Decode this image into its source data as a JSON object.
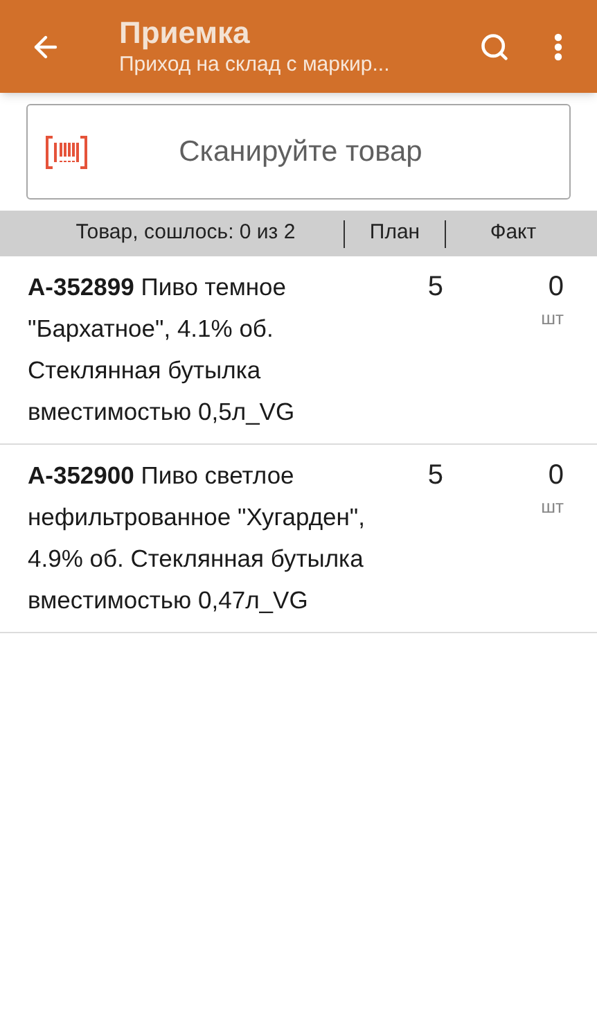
{
  "app_bar": {
    "title": "Приемка",
    "subtitle": "Приход на склад с маркир..."
  },
  "scan_field": {
    "placeholder": "Сканируйте товар"
  },
  "table": {
    "columns": [
      "Товар, сошлось: 0 из 2",
      "План",
      "Факт"
    ],
    "rows": [
      {
        "item": "**А-352899** Пиво темное \"Бархатное\", 4.1% об. Стеклянная бутылка вместимостью 0,5л_VG",
        "plan": "5",
        "fact": "0",
        "unit": "шт"
      },
      {
        "item": "**А-352900** Пиво светлое нефильтрованное \"Хугарден\", 4.9% об. Стеклянная бутылка вместимостью 0,47л_VG",
        "plan": "5",
        "fact": "0",
        "unit": "шт"
      }
    ]
  }
}
